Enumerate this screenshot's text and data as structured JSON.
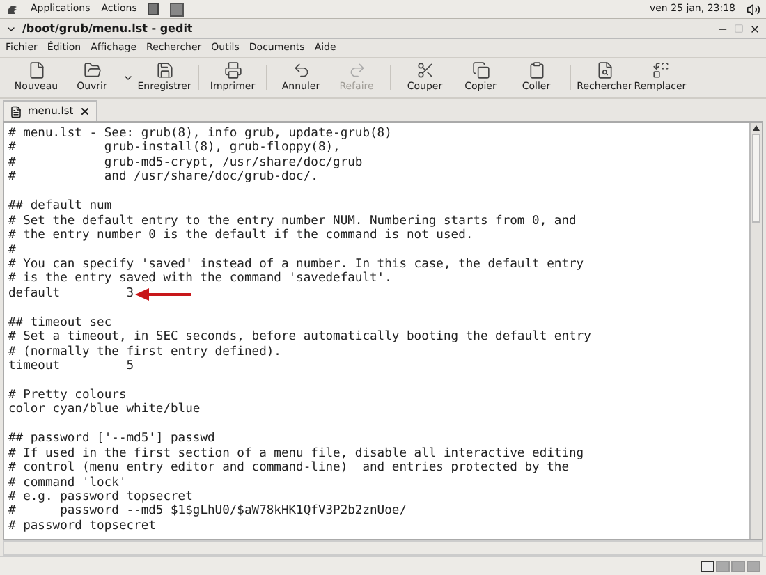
{
  "top_panel": {
    "menus": [
      "Applications",
      "Actions"
    ],
    "clock": "ven 25 jan, 23:18"
  },
  "window": {
    "title": "/boot/grub/menu.lst - gedit"
  },
  "menubar": [
    "Fichier",
    "Édition",
    "Affichage",
    "Rechercher",
    "Outils",
    "Documents",
    "Aide"
  ],
  "toolbar": [
    {
      "kind": "new",
      "label": "Nouveau",
      "disabled": false
    },
    {
      "kind": "open",
      "label": "Ouvrir",
      "disabled": false
    },
    {
      "kind": "save",
      "label": "Enregistrer",
      "disabled": false
    },
    {
      "kind": "print",
      "label": "Imprimer",
      "disabled": false
    },
    {
      "kind": "undo",
      "label": "Annuler",
      "disabled": false
    },
    {
      "kind": "redo",
      "label": "Refaire",
      "disabled": true
    },
    {
      "kind": "cut",
      "label": "Couper",
      "disabled": false
    },
    {
      "kind": "copy",
      "label": "Copier",
      "disabled": false
    },
    {
      "kind": "paste",
      "label": "Coller",
      "disabled": false
    },
    {
      "kind": "find",
      "label": "Rechercher",
      "disabled": false
    },
    {
      "kind": "replace",
      "label": "Remplacer",
      "disabled": false
    }
  ],
  "tabs": [
    {
      "label": "menu.lst",
      "selected": true
    }
  ],
  "editor": {
    "lines": [
      {
        "kind": "text",
        "text": "# menu.lst - See: grub(8), info grub, update-grub(8)"
      },
      {
        "kind": "text",
        "text": "#            grub-install(8), grub-floppy(8),"
      },
      {
        "kind": "text",
        "text": "#            grub-md5-crypt, /usr/share/doc/grub"
      },
      {
        "kind": "text",
        "text": "#            and /usr/share/doc/grub-doc/."
      },
      {
        "kind": "blank"
      },
      {
        "kind": "text",
        "text": "## default num"
      },
      {
        "kind": "text",
        "text": "# Set the default entry to the entry number NUM. Numbering starts from 0, and"
      },
      {
        "kind": "text",
        "text": "# the entry number 0 is the default if the command is not used."
      },
      {
        "kind": "text",
        "text": "#"
      },
      {
        "kind": "text",
        "text": "# You can specify 'saved' instead of a number. In this case, the default entry"
      },
      {
        "kind": "text",
        "text": "# is the entry saved with the command 'savedefault'."
      },
      {
        "kind": "marked",
        "text": "default         3"
      },
      {
        "kind": "blank"
      },
      {
        "kind": "text",
        "text": "## timeout sec"
      },
      {
        "kind": "text",
        "text": "# Set a timeout, in SEC seconds, before automatically booting the default entry"
      },
      {
        "kind": "text",
        "text": "# (normally the first entry defined)."
      },
      {
        "kind": "text",
        "text": "timeout         5"
      },
      {
        "kind": "blank"
      },
      {
        "kind": "text",
        "text": "# Pretty colours"
      },
      {
        "kind": "text",
        "text": "color cyan/blue white/blue"
      },
      {
        "kind": "blank"
      },
      {
        "kind": "text",
        "text": "## password ['--md5'] passwd"
      },
      {
        "kind": "text",
        "text": "# If used in the first section of a menu file, disable all interactive editing"
      },
      {
        "kind": "text",
        "text": "# control (menu entry editor and command-line)  and entries protected by the"
      },
      {
        "kind": "text",
        "text": "# command 'lock'"
      },
      {
        "kind": "text",
        "text": "# e.g. password topsecret"
      },
      {
        "kind": "text",
        "text": "#      password --md5 $1$gLhU0/$aW78kHK1QfV3P2b2znUoe/"
      },
      {
        "kind": "text",
        "text": "# password topsecret"
      }
    ]
  },
  "workspaces": [
    {
      "selected": true
    },
    {
      "selected": false
    },
    {
      "selected": false
    },
    {
      "selected": false
    }
  ]
}
